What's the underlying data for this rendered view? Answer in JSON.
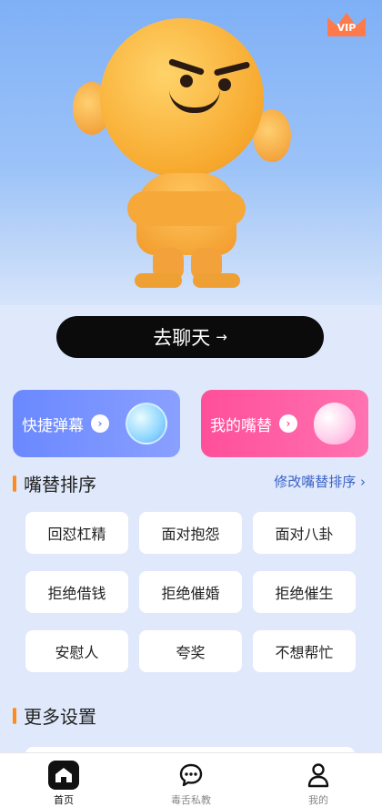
{
  "vip": {
    "label": "VIP"
  },
  "hero": {
    "cta_label": "去聊天",
    "cta_arrow": "→"
  },
  "cards": [
    {
      "label": "快捷弹幕",
      "chevron": "›"
    },
    {
      "label": "我的嘴替",
      "chevron": "›"
    }
  ],
  "sort_section": {
    "title": "嘴替排序",
    "edit_label": "修改嘴替排序",
    "edit_chevron": "›"
  },
  "chips": [
    "回怼杠精",
    "面对抱怨",
    "面对八卦",
    "拒绝借钱",
    "拒绝催婚",
    "拒绝催生",
    "安慰人",
    "夸奖",
    "不想帮忙"
  ],
  "more_section": {
    "title": "更多设置"
  },
  "tabbar": {
    "items": [
      {
        "label": "首页",
        "icon": "home-icon",
        "active": true
      },
      {
        "label": "毒舌私教",
        "icon": "chat-bubble-icon",
        "active": false
      },
      {
        "label": "我的",
        "icon": "user-icon",
        "active": false
      }
    ]
  },
  "colors": {
    "accent_orange": "#ff8a1e",
    "link_blue": "#3b63c7",
    "card_blue": "#6a88ff",
    "card_pink": "#ff4f9a",
    "cta_black": "#0b0b0b"
  }
}
